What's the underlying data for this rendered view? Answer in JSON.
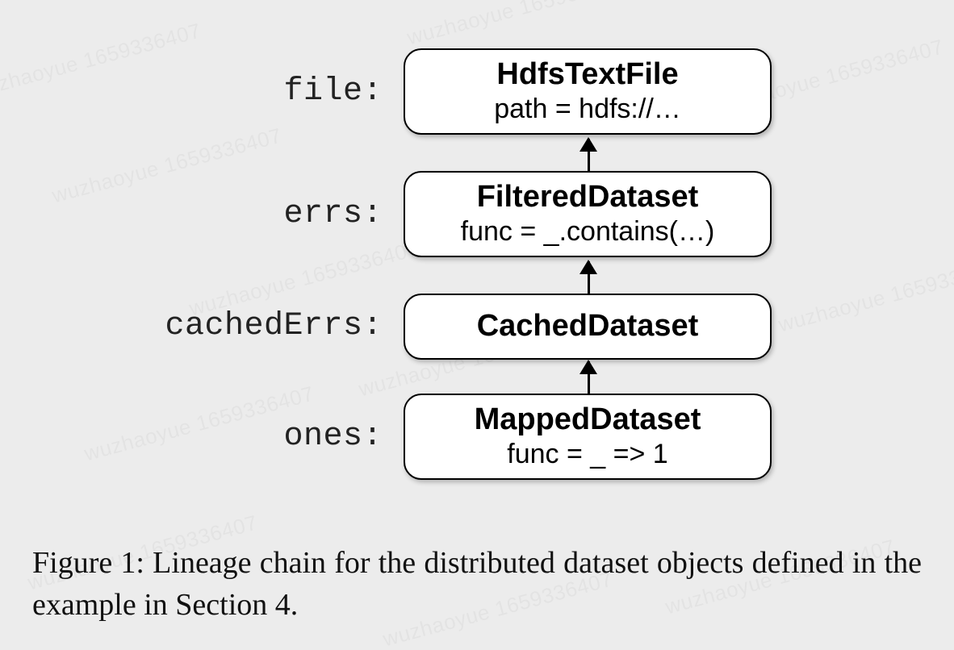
{
  "watermark": "wuzhaoyue 1659336407",
  "rows": [
    {
      "label": "file:",
      "node_title": "HdfsTextFile",
      "node_sub": "path = hdfs://…"
    },
    {
      "label": "errs:",
      "node_title": "FilteredDataset",
      "node_sub": "func = _.contains(…)"
    },
    {
      "label": "cachedErrs:",
      "node_title": "CachedDataset",
      "node_sub": ""
    },
    {
      "label": "ones:",
      "node_title": "MappedDataset",
      "node_sub": "func = _ => 1"
    }
  ],
  "caption": "Figure 1: Lineage chain for the distributed dataset objects defined in the example in Section 4."
}
